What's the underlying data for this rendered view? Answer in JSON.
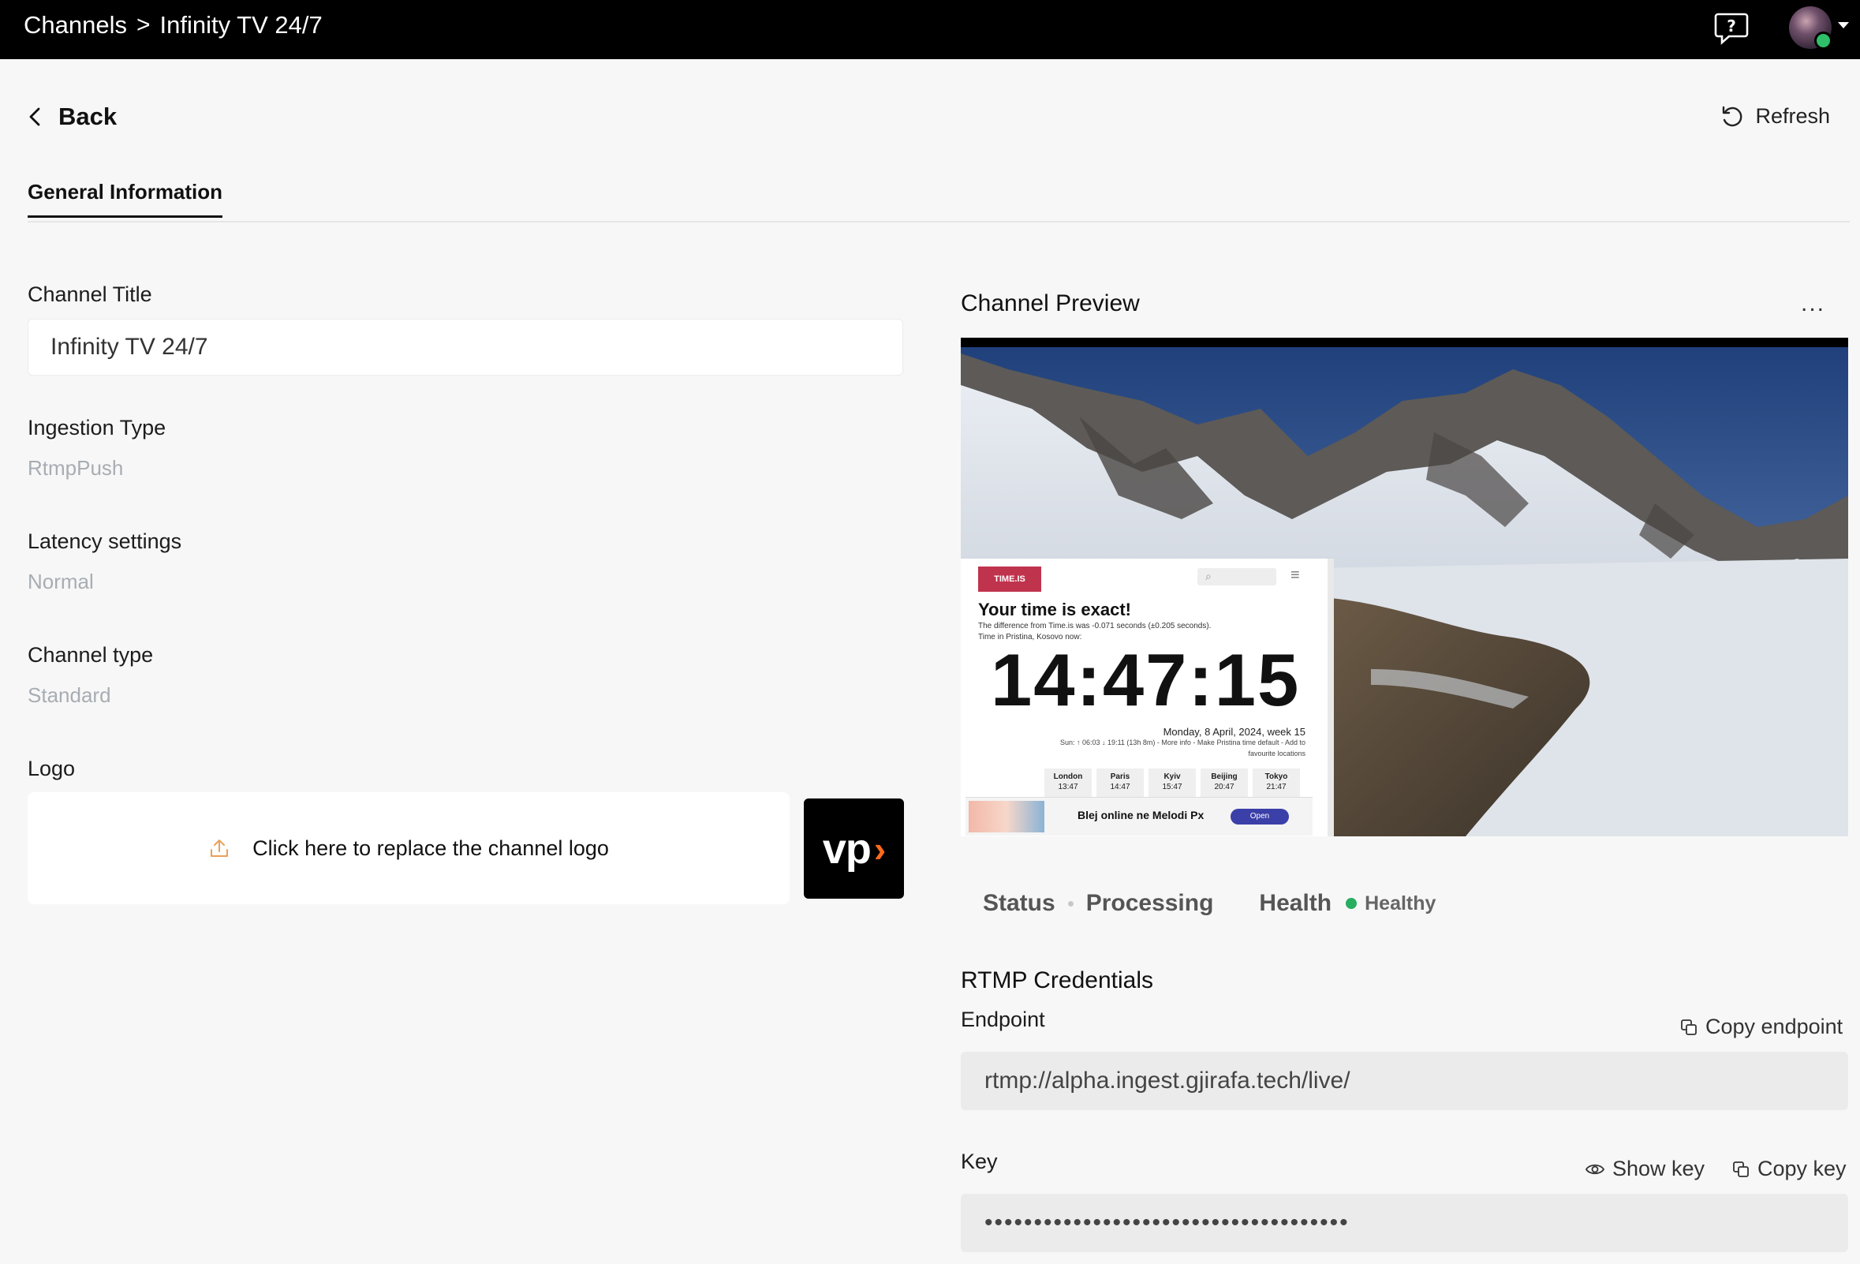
{
  "header": {
    "breadcrumb_root": "Channels",
    "breadcrumb_separator": ">",
    "breadcrumb_current": "Infinity TV 24/7"
  },
  "toolbar": {
    "back_label": "Back",
    "refresh_label": "Refresh"
  },
  "tabs": [
    {
      "label": "General Information",
      "active": true
    }
  ],
  "form": {
    "title_label": "Channel Title",
    "title_value": "Infinity TV 24/7",
    "ingestion_label": "Ingestion Type",
    "ingestion_value": "RtmpPush",
    "latency_label": "Latency settings",
    "latency_value": "Normal",
    "type_label": "Channel type",
    "type_value": "Standard",
    "logo_label": "Logo",
    "logo_replace_text": "Click here to replace the channel logo",
    "logo_mark": "vp",
    "logo_chevron": "›"
  },
  "preview": {
    "title": "Channel Preview",
    "menu": "...",
    "overlay": {
      "brand": "TIME.IS",
      "headline": "Your time is exact!",
      "difference": "The difference from Time.is was -0.071 seconds (±0.205 seconds).",
      "location": "Time in Pristina, Kosovo now:",
      "clock": "14:47:15",
      "date": "Monday, 8 April, 2024, week 15",
      "sunline1": "Sun: ↑ 06:03 ↓ 19:11 (13h 8m) - More info - Make Pristina time default - Add to",
      "sunline2": "favourite locations",
      "cities": [
        {
          "city": "London",
          "time": "13:47"
        },
        {
          "city": "Paris",
          "time": "14:47"
        },
        {
          "city": "Kyiv",
          "time": "15:47"
        },
        {
          "city": "Beijing",
          "time": "20:47"
        },
        {
          "city": "Tokyo",
          "time": "21:47"
        }
      ],
      "ad_text": "Blej online ne Melodi Px",
      "ad_button": "Open"
    }
  },
  "status": {
    "status_label": "Status",
    "status_value": "Processing",
    "health_label": "Health",
    "health_value": "Healthy",
    "health_color": "#27ae60"
  },
  "rtmp": {
    "title": "RTMP Credentials",
    "endpoint_label": "Endpoint",
    "copy_endpoint": "Copy endpoint",
    "endpoint_value": "rtmp://alpha.ingest.gjirafa.tech/live/",
    "key_label": "Key",
    "show_key": "Show key",
    "copy_key": "Copy key",
    "key_masked": "•••••••••••••••••••••••••••••••••••••"
  }
}
